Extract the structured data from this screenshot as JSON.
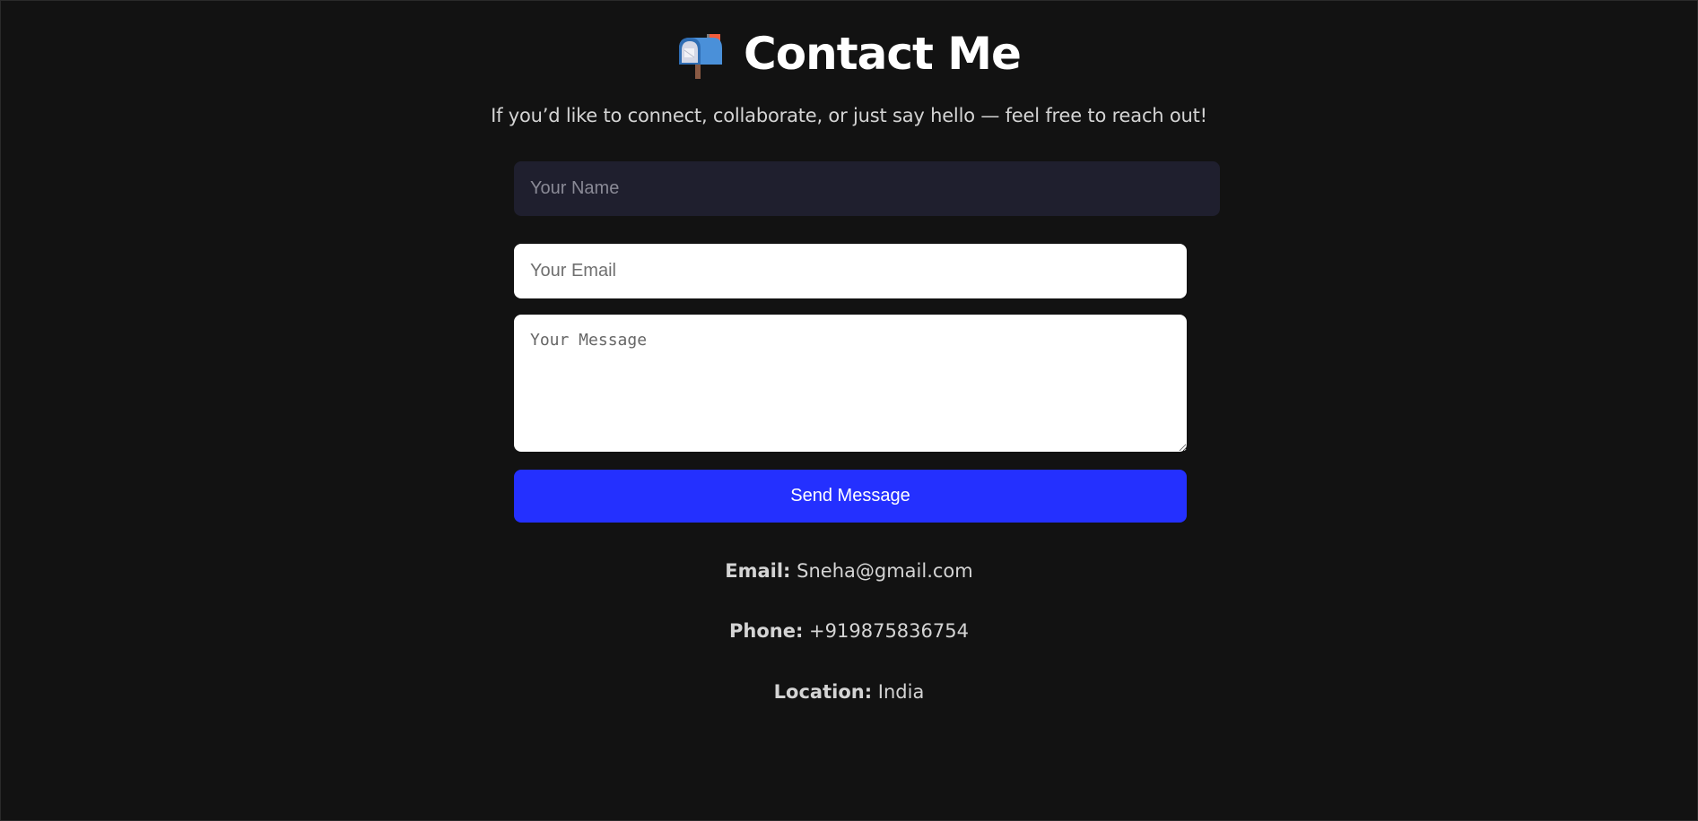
{
  "header": {
    "icon": "mailbox-icon",
    "title": "Contact Me",
    "subtitle": "If you’d like to connect, collaborate, or just say hello — feel free to reach out!"
  },
  "form": {
    "name_placeholder": "Your Name",
    "email_placeholder": "Your Email",
    "message_placeholder": "Your Message",
    "submit_label": "Send Message"
  },
  "contact_info": {
    "email": {
      "label": "Email:",
      "value": "Sneha@gmail.com"
    },
    "phone": {
      "label": "Phone:",
      "value": "+919875836754"
    },
    "location": {
      "label": "Location:",
      "value": "India"
    }
  },
  "colors": {
    "background": "#121212",
    "button": "#2430ff",
    "name_field_bg": "#1f1f2e"
  }
}
